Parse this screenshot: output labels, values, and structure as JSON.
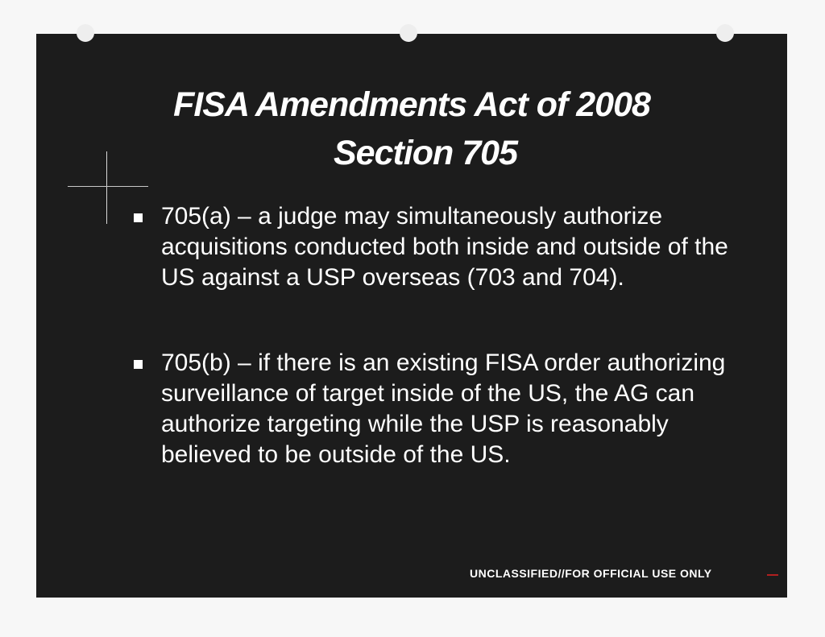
{
  "slide": {
    "title_line1": "FISA Amendments Act of 2008",
    "title_line2": "Section 705",
    "bullets": [
      {
        "text": "705(a) – a judge may simultaneously authorize acquisitions conducted both inside and outside of the US against a USP overseas (703 and 704)."
      },
      {
        "text": "705(b) – if there is an existing FISA order authorizing surveillance of target inside of the US, the AG can authorize targeting while the USP is reasonably believed to be outside of the US."
      }
    ],
    "classification": "UNCLASSIFIED//FOR OFFICIAL USE ONLY"
  },
  "colors": {
    "slide_background": "#1c1c1c",
    "text": "#ffffff",
    "paper": "#f7f7f7"
  }
}
